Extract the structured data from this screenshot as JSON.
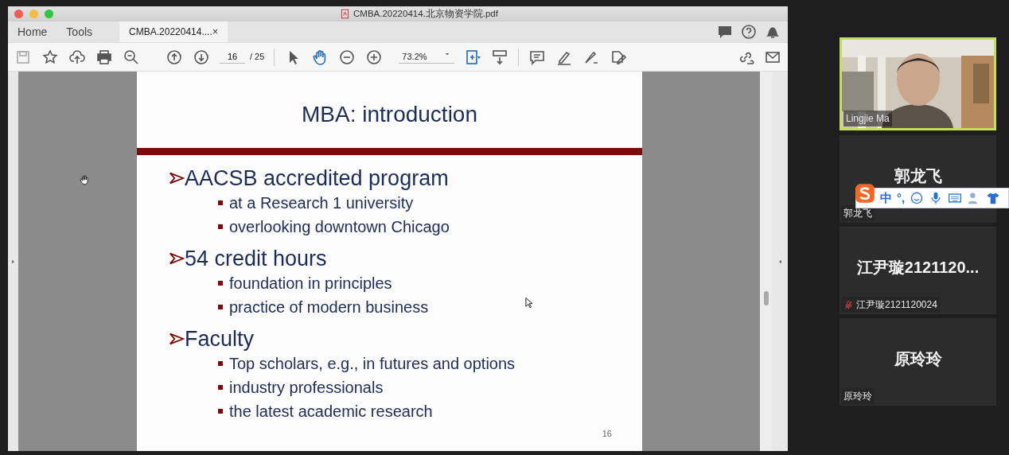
{
  "window": {
    "title": "CMBA.20220414.北京物资学院.pdf"
  },
  "tabs": [
    {
      "label": "Home",
      "selected": false
    },
    {
      "label": "Tools",
      "selected": false
    },
    {
      "label": "CMBA.20220414....",
      "selected": true,
      "close": "×"
    }
  ],
  "toolbar": {
    "page": "16",
    "page_total": "/ 25",
    "zoom": "73.2%",
    "tools": [
      {
        "selected": false
      },
      {
        "selected": true
      }
    ]
  },
  "slide": {
    "title": "MBA: introduction",
    "page_number": "16",
    "bullets": [
      {
        "text": "AACSB accredited program",
        "children": [
          {
            "text": "at a Research 1 university"
          },
          {
            "text": "overlooking downtown Chicago"
          }
        ]
      },
      {
        "text": "54 credit hours",
        "children": [
          {
            "text": "foundation in principles"
          },
          {
            "text": "practice of modern business"
          }
        ]
      },
      {
        "text": "Faculty",
        "children": [
          {
            "text": "Top scholars, e.g.,  in futures and options"
          },
          {
            "text": "industry professionals"
          },
          {
            "text": "the latest academic research"
          }
        ]
      }
    ]
  },
  "participants": [
    {
      "kind": "video",
      "label": "Lingjie Ma",
      "speaking": true,
      "muted": false
    },
    {
      "kind": "name",
      "display": "郭龙飞",
      "label": "郭龙飞",
      "speaking": false,
      "muted": false
    },
    {
      "kind": "name",
      "display": "江尹璇2121120...",
      "label": "江尹璇2121120024",
      "speaking": false,
      "muted": true
    },
    {
      "kind": "name",
      "display": "原玲玲",
      "label": "原玲玲",
      "speaking": false,
      "muted": false
    }
  ],
  "ime_bar": {
    "mode": "中",
    "punct": "°,"
  }
}
